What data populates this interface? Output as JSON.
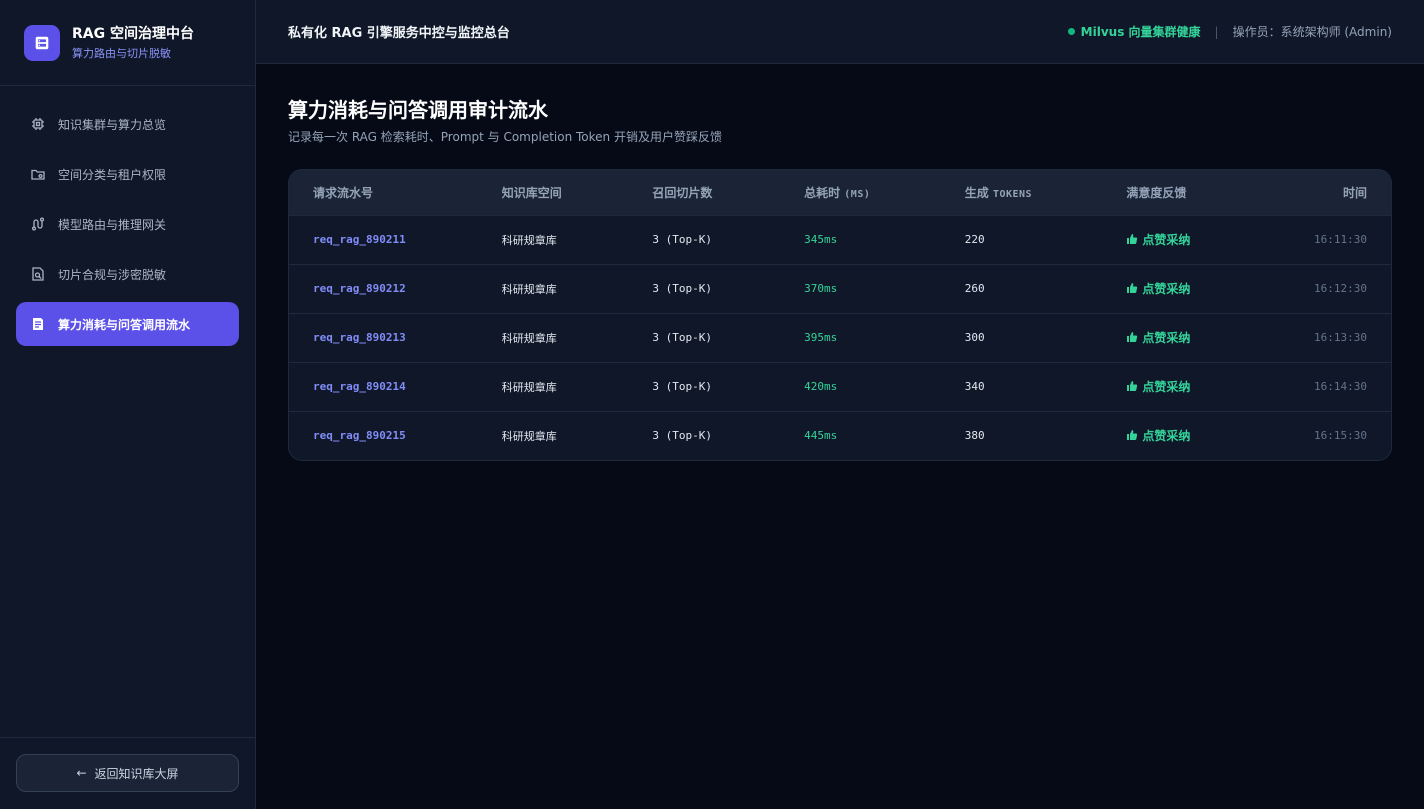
{
  "brand": {
    "title": "RAG 空间治理中台",
    "subtitle": "算力路由与切片脱敏"
  },
  "nav": {
    "items": [
      {
        "label": "知识集群与算力总览",
        "icon": "chip-icon"
      },
      {
        "label": "空间分类与租户权限",
        "icon": "folder-icon"
      },
      {
        "label": "模型路由与推理网关",
        "icon": "route-icon"
      },
      {
        "label": "切片合规与涉密脱敏",
        "icon": "scan-icon"
      },
      {
        "label": "算力消耗与问答调用流水",
        "icon": "ledger-icon",
        "active": true
      }
    ],
    "back_label": "返回知识库大屏"
  },
  "header": {
    "title": "私有化 RAG 引擎服务中控与监控总台",
    "status": "Milvus 向量集群健康",
    "separator": "|",
    "operator": "操作员：系统架构师 (Admin)"
  },
  "main": {
    "title": "算力消耗与问答调用审计流水",
    "subtitle": "记录每一次 RAG 检索耗时、Prompt 与 Completion Token 开销及用户赞踩反馈"
  },
  "table": {
    "headers": {
      "req_id": "请求流水号",
      "space": "知识库空间",
      "chunks": "召回切片数",
      "latency_main": "总耗时",
      "latency_unit": "(MS)",
      "tokens_main": "生成",
      "tokens_unit": "TOKENS",
      "feedback": "满意度反馈",
      "time": "时间"
    },
    "rows": [
      {
        "req_id": "req_rag_890211",
        "space": "科研规章库",
        "chunks": "3 (Top-K)",
        "latency": "345ms",
        "tokens": "220",
        "feedback": "点赞采纳",
        "time": "16:11:30"
      },
      {
        "req_id": "req_rag_890212",
        "space": "科研规章库",
        "chunks": "3 (Top-K)",
        "latency": "370ms",
        "tokens": "260",
        "feedback": "点赞采纳",
        "time": "16:12:30"
      },
      {
        "req_id": "req_rag_890213",
        "space": "科研规章库",
        "chunks": "3 (Top-K)",
        "latency": "395ms",
        "tokens": "300",
        "feedback": "点赞采纳",
        "time": "16:13:30"
      },
      {
        "req_id": "req_rag_890214",
        "space": "科研规章库",
        "chunks": "3 (Top-K)",
        "latency": "420ms",
        "tokens": "340",
        "feedback": "点赞采纳",
        "time": "16:14:30"
      },
      {
        "req_id": "req_rag_890215",
        "space": "科研规章库",
        "chunks": "3 (Top-K)",
        "latency": "445ms",
        "tokens": "380",
        "feedback": "点赞采纳",
        "time": "16:15:30"
      }
    ]
  },
  "colors": {
    "accent": "#5b50e8",
    "request_id": "#818cf8",
    "success": "#34d399",
    "background": "#050a16",
    "panel": "#0f1728"
  }
}
